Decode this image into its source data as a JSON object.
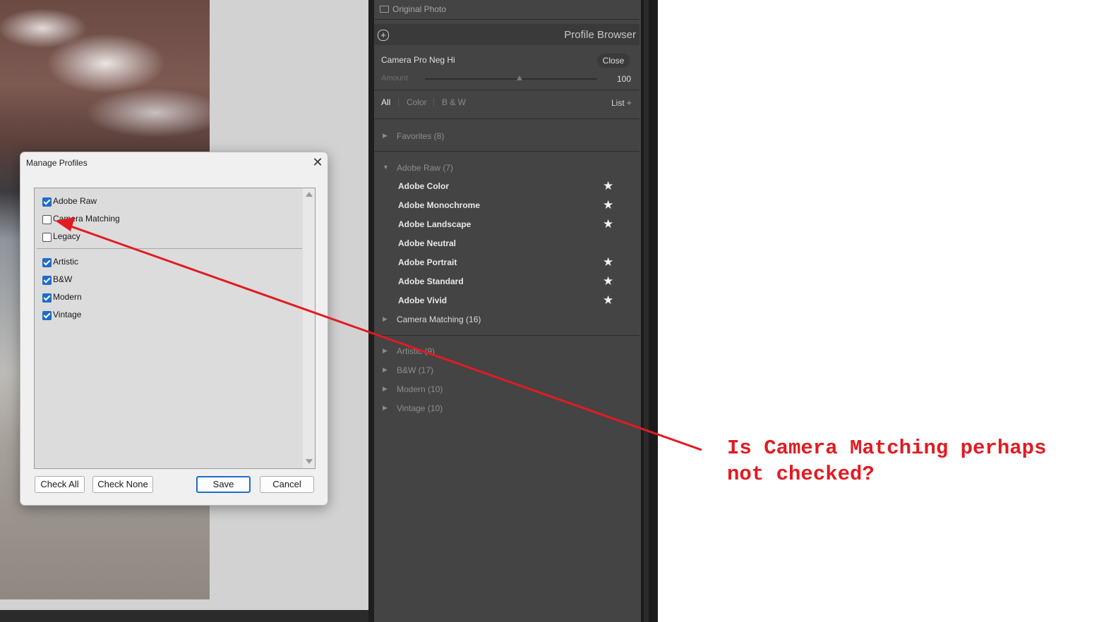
{
  "photo_panel": {
    "original_photo_label": "Original Photo"
  },
  "profile_browser": {
    "title": "Profile Browser",
    "selected_profile": "Camera Pro Neg Hi",
    "close_label": "Close",
    "amount_label": "Amount",
    "amount_value": "100",
    "amount_level": 0.55,
    "filter_tabs": [
      {
        "label": "All",
        "active": true
      },
      {
        "label": "Color",
        "active": false
      },
      {
        "label": "B & W",
        "active": false
      }
    ],
    "view_mode": "List ÷",
    "groups": {
      "favorites": "Favorites (8)",
      "adobe_raw": "Adobe Raw (7)",
      "camera_matching": "Camera Matching (16)",
      "artistic": "Artistic (9)",
      "bw": "B&W (17)",
      "modern": "Modern (10)",
      "vintage": "Vintage (10)"
    },
    "adobe_raw_items": [
      {
        "label": "Adobe Color",
        "favorite": true
      },
      {
        "label": "Adobe Monochrome",
        "favorite": true
      },
      {
        "label": "Adobe Landscape",
        "favorite": true
      },
      {
        "label": "Adobe Neutral",
        "favorite": false
      },
      {
        "label": "Adobe Portrait",
        "favorite": true
      },
      {
        "label": "Adobe Standard",
        "favorite": true
      },
      {
        "label": "Adobe Vivid",
        "favorite": true
      }
    ],
    "star_glyph": "★",
    "expand_glyph": "▶",
    "collapse_glyph": "▼",
    "plus_glyph": "+"
  },
  "manage_profiles_dialog": {
    "title": "Manage Profiles",
    "close_glyph": "✕",
    "profile_groups": [
      {
        "label": "Adobe Raw",
        "checked": true
      },
      {
        "label": "Camera Matching",
        "checked": false
      },
      {
        "label": "Legacy",
        "checked": false
      }
    ],
    "style_groups": [
      {
        "label": "Artistic",
        "checked": true
      },
      {
        "label": "B&W",
        "checked": true
      },
      {
        "label": "Modern",
        "checked": true
      },
      {
        "label": "Vintage",
        "checked": true
      }
    ],
    "buttons": {
      "check_all": "Check All",
      "check_none": "Check None",
      "save": "Save",
      "cancel": "Cancel"
    }
  },
  "annotation": {
    "line1": "Is Camera Matching perhaps",
    "line2": "not checked?",
    "color": "#e21b22"
  }
}
